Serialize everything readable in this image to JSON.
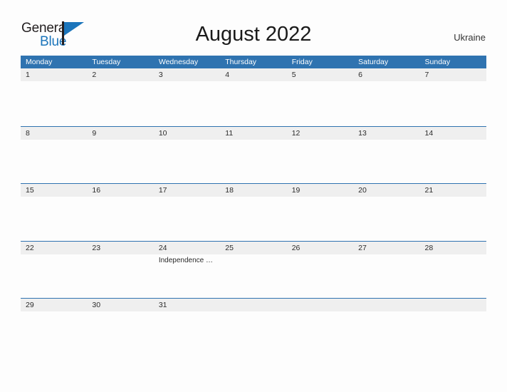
{
  "brand": {
    "name_part1": "General",
    "name_part2": "Blue",
    "flag_icon": "blue-flag-icon",
    "color_dark": "#231f20",
    "color_blue": "#1b75bb"
  },
  "header": {
    "title": "August 2022",
    "country": "Ukraine"
  },
  "theme": {
    "header_blue": "#2f73b0",
    "day_band_gray": "#efefef",
    "page_background": "#fdfdfd",
    "text_color": "#2b2b2b"
  },
  "calendar": {
    "month": "August",
    "year": "2022",
    "week_start": "Monday",
    "day_headers": [
      "Monday",
      "Tuesday",
      "Wednesday",
      "Thursday",
      "Friday",
      "Saturday",
      "Sunday"
    ],
    "weeks": [
      {
        "days": [
          {
            "num": "1",
            "events": []
          },
          {
            "num": "2",
            "events": []
          },
          {
            "num": "3",
            "events": []
          },
          {
            "num": "4",
            "events": []
          },
          {
            "num": "5",
            "events": []
          },
          {
            "num": "6",
            "events": []
          },
          {
            "num": "7",
            "events": []
          }
        ]
      },
      {
        "days": [
          {
            "num": "8",
            "events": []
          },
          {
            "num": "9",
            "events": []
          },
          {
            "num": "10",
            "events": []
          },
          {
            "num": "11",
            "events": []
          },
          {
            "num": "12",
            "events": []
          },
          {
            "num": "13",
            "events": []
          },
          {
            "num": "14",
            "events": []
          }
        ]
      },
      {
        "days": [
          {
            "num": "15",
            "events": []
          },
          {
            "num": "16",
            "events": []
          },
          {
            "num": "17",
            "events": []
          },
          {
            "num": "18",
            "events": []
          },
          {
            "num": "19",
            "events": []
          },
          {
            "num": "20",
            "events": []
          },
          {
            "num": "21",
            "events": []
          }
        ]
      },
      {
        "days": [
          {
            "num": "22",
            "events": []
          },
          {
            "num": "23",
            "events": []
          },
          {
            "num": "24",
            "events": [
              "Independence Day"
            ]
          },
          {
            "num": "25",
            "events": []
          },
          {
            "num": "26",
            "events": []
          },
          {
            "num": "27",
            "events": []
          },
          {
            "num": "28",
            "events": []
          }
        ]
      },
      {
        "days": [
          {
            "num": "29",
            "events": []
          },
          {
            "num": "30",
            "events": []
          },
          {
            "num": "31",
            "events": []
          },
          {
            "num": "",
            "events": []
          },
          {
            "num": "",
            "events": []
          },
          {
            "num": "",
            "events": []
          },
          {
            "num": "",
            "events": []
          }
        ]
      }
    ],
    "holidays": [
      {
        "date": "24",
        "name": "Independence Day"
      }
    ]
  }
}
